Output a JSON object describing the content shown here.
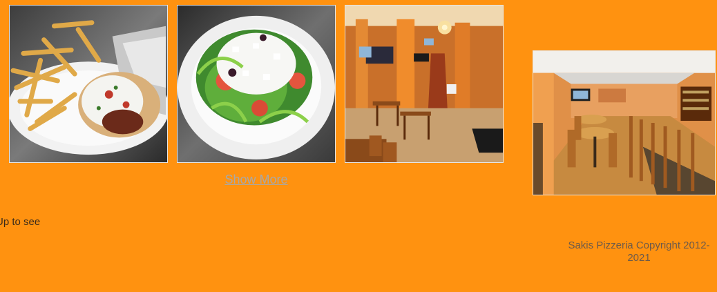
{
  "gallery": {
    "photos": [
      {
        "name": "gyro-with-fries",
        "icon": "gyro-fries-photo"
      },
      {
        "name": "greek-salad",
        "icon": "greek-salad-photo"
      },
      {
        "name": "restaurant-interior",
        "icon": "interior-photo"
      },
      {
        "name": "dining-room",
        "icon": "dining-room-photo"
      }
    ],
    "show_more_label": "Show More"
  },
  "signup": {
    "text": "Up to see"
  },
  "footer": {
    "copyright": "Sakis Pizzeria Copyright 2012-2021"
  },
  "colors": {
    "page_background": "#ff9210",
    "link": "#a8a8a8"
  }
}
